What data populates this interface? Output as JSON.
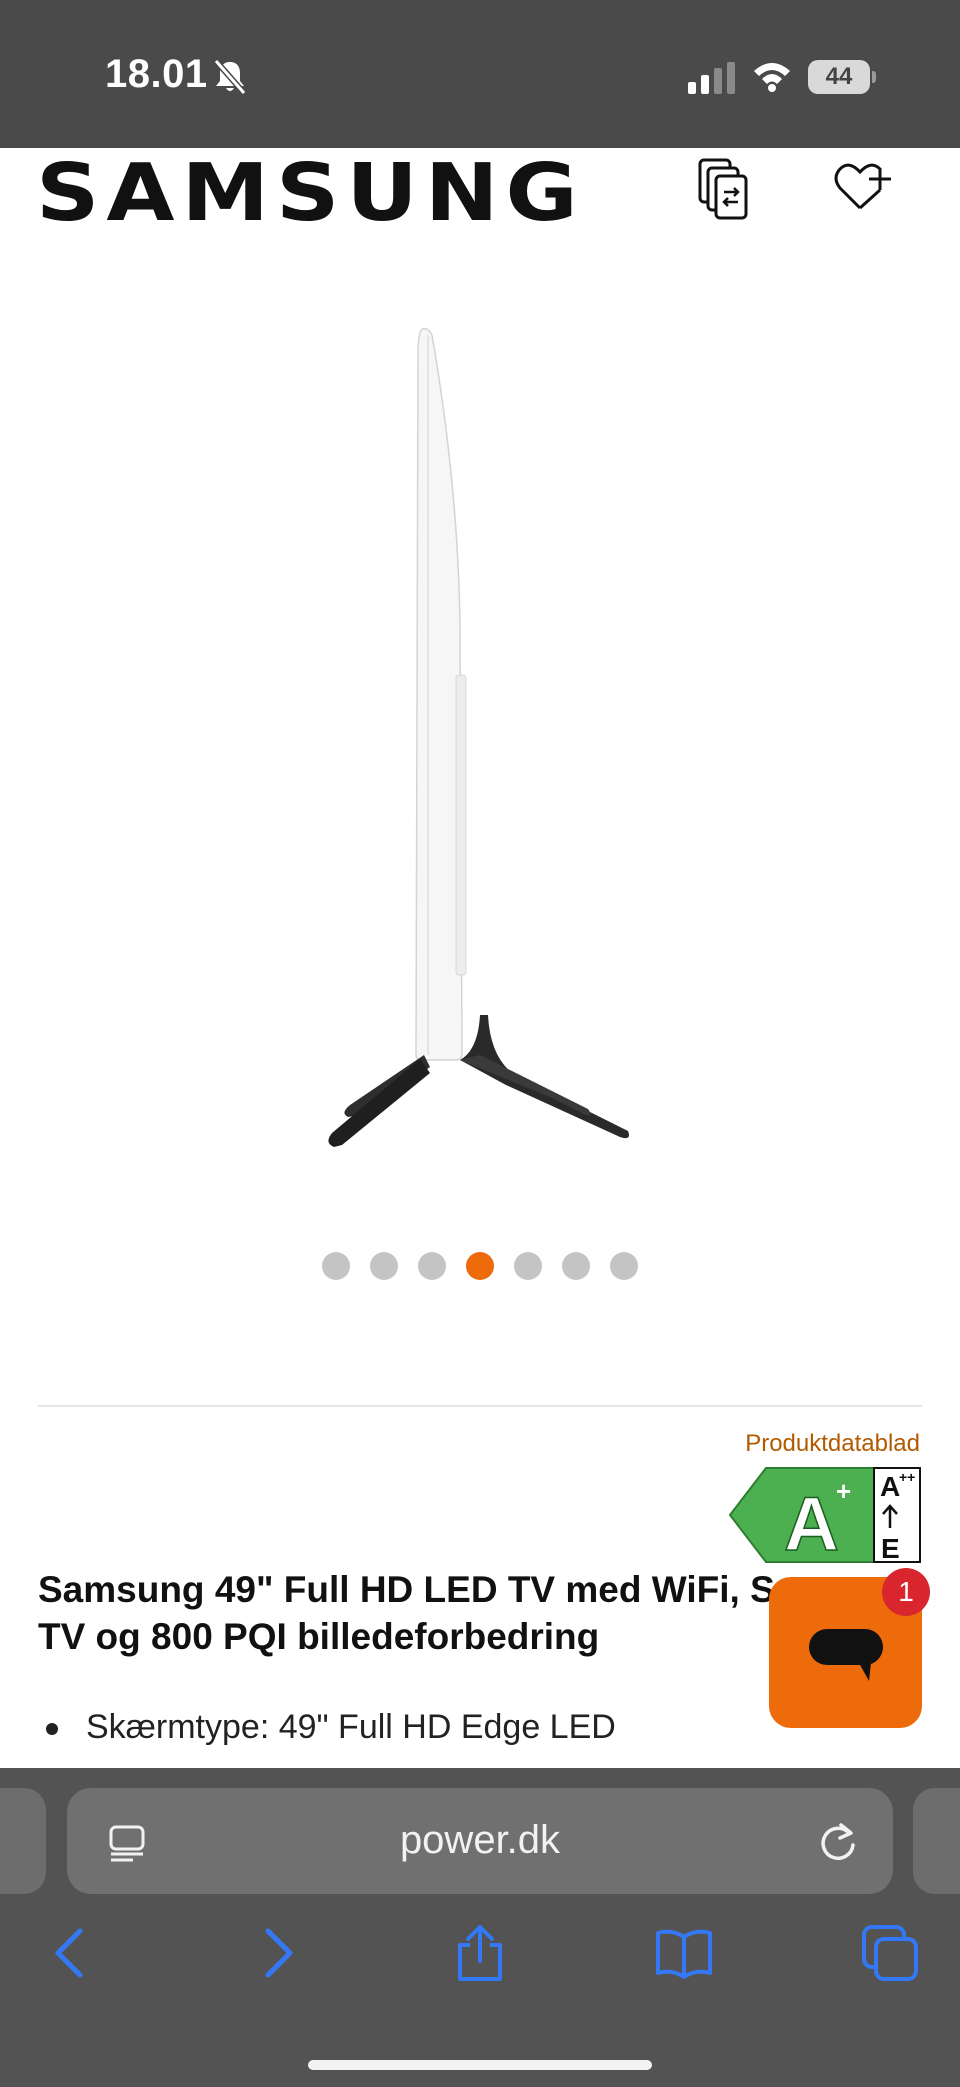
{
  "status_bar": {
    "time": "18.01",
    "battery": "44"
  },
  "header": {
    "brand": "SAMSUNG",
    "compare_icon": "compare-icon",
    "wishlist_icon": "heart-plus-icon"
  },
  "carousel": {
    "total": 7,
    "active_index": 4
  },
  "product": {
    "datasheet_link": "Produktdatablad",
    "energy_class": "A",
    "energy_class_sup": "+",
    "energy_scale_top": "A",
    "energy_scale_top_sup": "++",
    "energy_scale_bottom": "E",
    "title": "Samsung 49\" Full HD LED TV med WiFi, Smart TV og 800 PQI billedeforbedring",
    "bullets": [
      "Skærmtype: 49\" Full HD Edge LED"
    ]
  },
  "chat": {
    "badge": "1"
  },
  "browser": {
    "url": "power.dk"
  },
  "colors": {
    "accent": "#ee6b0c",
    "status_bar": "#4a4a4a",
    "browser_bar": "#535353",
    "safari_blue": "#3478f6",
    "energy_green": "#4caf50",
    "badge_red": "#d9262e"
  }
}
